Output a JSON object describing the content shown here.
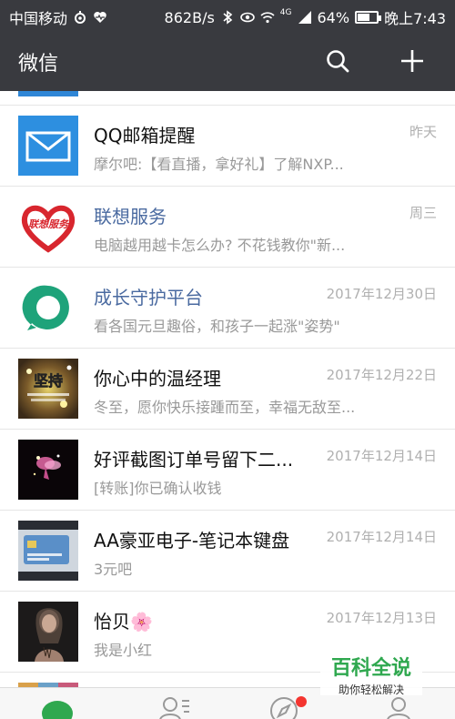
{
  "status_bar": {
    "carrier": "中国移动",
    "network_speed": "862B/s",
    "battery_percent": "64%",
    "battery_level": 0.64,
    "time": "晚上7:43",
    "signal_type": "4G"
  },
  "header": {
    "title": "微信",
    "search_icon": "search-icon",
    "add_icon": "plus-icon"
  },
  "chats": [
    {
      "name": "QQ邮箱提醒",
      "preview": "摩尔吧:【看直播，拿好礼】了解NXP...",
      "time": "昨天",
      "avatar": "mail-envelope",
      "name_link": false
    },
    {
      "name": "联想服务",
      "preview": "电脑越用越卡怎么办? 不花钱教你\"新...",
      "time": "周三",
      "avatar": "lenovo-service-logo",
      "avatar_text": "联想服务",
      "name_link": true
    },
    {
      "name": "成长守护平台",
      "preview": "看各国元旦趣俗，和孩子一起涨\"姿势\"",
      "time": "2017年12月30日",
      "avatar": "green-ring-logo",
      "name_link": true
    },
    {
      "name": "你心中的温经理",
      "preview": "冬至，愿你快乐接踵而至，幸福无敌至...",
      "time": "2017年12月22日",
      "avatar": "photo-persist",
      "avatar_text": "坚持",
      "name_link": false
    },
    {
      "name": "好评截图订单号留下二...",
      "preview": "[转账]你已确认收钱",
      "time": "2017年12月14日",
      "avatar": "photo-dark-fairy",
      "name_link": false
    },
    {
      "name": "AA豪亚电子-笔记本键盘",
      "preview": "3元吧",
      "time": "2017年12月14日",
      "avatar": "photo-card",
      "name_link": false
    },
    {
      "name": "怡贝🌸",
      "preview": "我是小红",
      "time": "2017年12月13日",
      "avatar": "photo-woman",
      "name_link": false
    }
  ],
  "bottom_nav": {
    "items": [
      "chat-bubble-icon",
      "contacts-icon",
      "discover-compass-icon",
      "me-icon"
    ],
    "discover_badge": true
  },
  "watermark": {
    "title": "百科全说",
    "subtitle": "助你轻松解决"
  },
  "colors": {
    "bar": "#393a3f",
    "accent_green": "#2fa84f",
    "badge_red": "#f43530"
  }
}
